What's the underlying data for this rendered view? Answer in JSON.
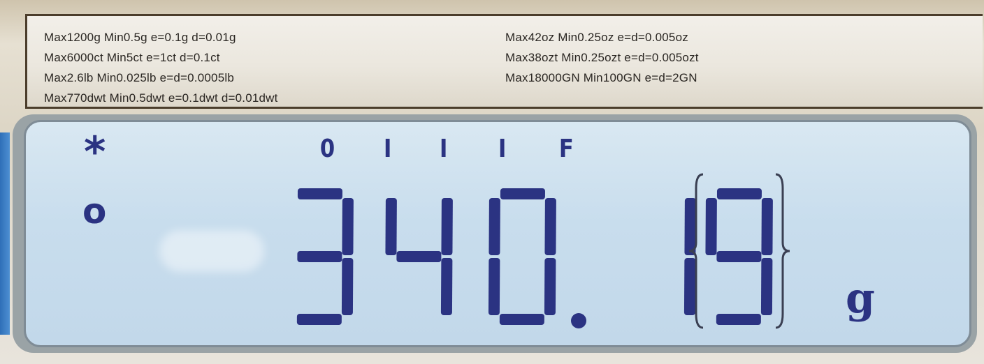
{
  "specs": {
    "left": [
      "Max1200g Min0.5g  e=0.1g  d=0.01g",
      "Max6000ct Min5ct  e=1ct  d=0.1ct",
      "Max2.6lb Min0.025lb  e=d=0.0005lb",
      "Max770dwt Min0.5dwt  e=0.1dwt  d=0.01dwt"
    ],
    "right": [
      "Max42oz Min0.25oz  e=d=0.005oz",
      "Max38ozt Min0.25ozt  e=d=0.005ozt",
      "Max18000GN Min100GN  e=d=2GN"
    ]
  },
  "display": {
    "star_indicator": "*",
    "circle_indicator": "o",
    "status_marks": [
      "0",
      "I",
      "I",
      "I",
      "F"
    ],
    "reading": "340.19",
    "unit": "g"
  },
  "colors": {
    "lcd_background": "#c8dded",
    "segment": "#2b3382"
  }
}
